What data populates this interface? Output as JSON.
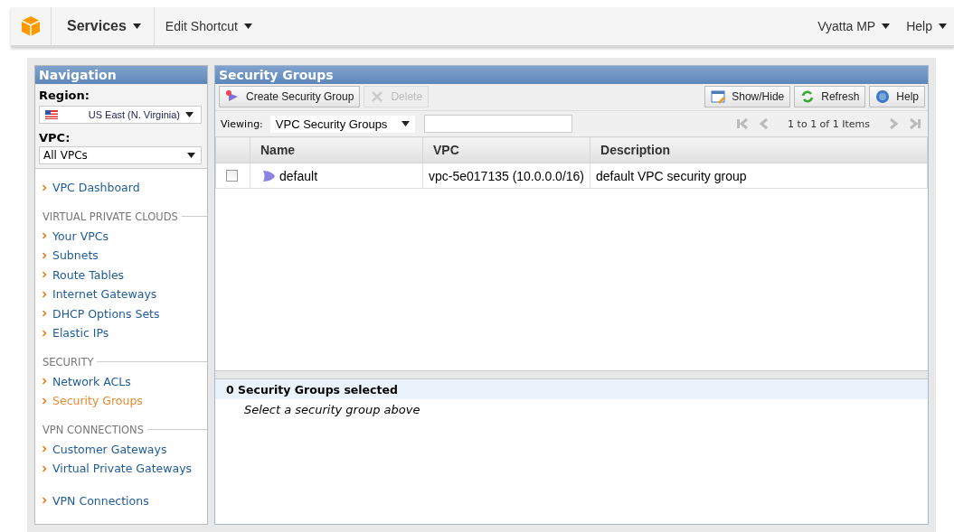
{
  "top_bar": {
    "menus": [
      {
        "label": "Services",
        "kind": "main"
      },
      {
        "label": "Edit Shortcut",
        "kind": "plain"
      }
    ],
    "right_menus": [
      {
        "label": "Vyatta MP"
      },
      {
        "label": "Help"
      }
    ]
  },
  "navigation": {
    "title": "Navigation",
    "region_label": "Region:",
    "region_value": "US East (N. Virginia)",
    "vpc_label": "VPC:",
    "vpc_value": "All VPCs",
    "sections": [
      {
        "items": [
          {
            "label": "VPC Dashboard",
            "selected": false
          }
        ]
      },
      {
        "title": "VIRTUAL PRIVATE CLOUDS",
        "items": [
          {
            "label": "Your VPCs",
            "selected": false
          },
          {
            "label": "Subnets",
            "selected": false
          },
          {
            "label": "Route Tables",
            "selected": false
          },
          {
            "label": "Internet Gateways",
            "selected": false
          },
          {
            "label": "DHCP Options Sets",
            "selected": false
          },
          {
            "label": "Elastic IPs",
            "selected": false
          }
        ]
      },
      {
        "title": "SECURITY",
        "items": [
          {
            "label": "Network ACLs",
            "selected": false
          },
          {
            "label": "Security Groups",
            "selected": true
          }
        ]
      },
      {
        "title": "VPN CONNECTIONS",
        "items": [
          {
            "label": "Customer Gateways",
            "selected": false
          },
          {
            "label": "Virtual Private Gateways",
            "selected": false
          }
        ]
      },
      {
        "items": [
          {
            "label": "VPN Connections",
            "selected": false
          }
        ]
      }
    ]
  },
  "main": {
    "title": "Security Groups",
    "toolbar_left": [
      {
        "label": "Create Security Group",
        "kind": "create",
        "disabled": false
      },
      {
        "label": "Delete",
        "kind": "delete",
        "disabled": true
      }
    ],
    "toolbar_right": [
      {
        "label": "Show/Hide",
        "kind": "columns",
        "disabled": false
      },
      {
        "label": "Refresh",
        "kind": "refresh",
        "disabled": false
      },
      {
        "label": "Help",
        "kind": "help",
        "disabled": false
      }
    ],
    "viewing_label": "Viewing:",
    "viewing_value": "VPC Security Groups",
    "pager_text": "1 to 1 of 1 Items",
    "table": {
      "columns": [
        "Name",
        "VPC",
        "Description"
      ],
      "rows": [
        {
          "checked": false,
          "name": "default",
          "vpc": "vpc-5e017135 (10.0.0.0/16)",
          "description": "default VPC security group"
        }
      ]
    },
    "detail": {
      "title": "0 Security Groups selected",
      "message": "Select a security group above"
    }
  }
}
